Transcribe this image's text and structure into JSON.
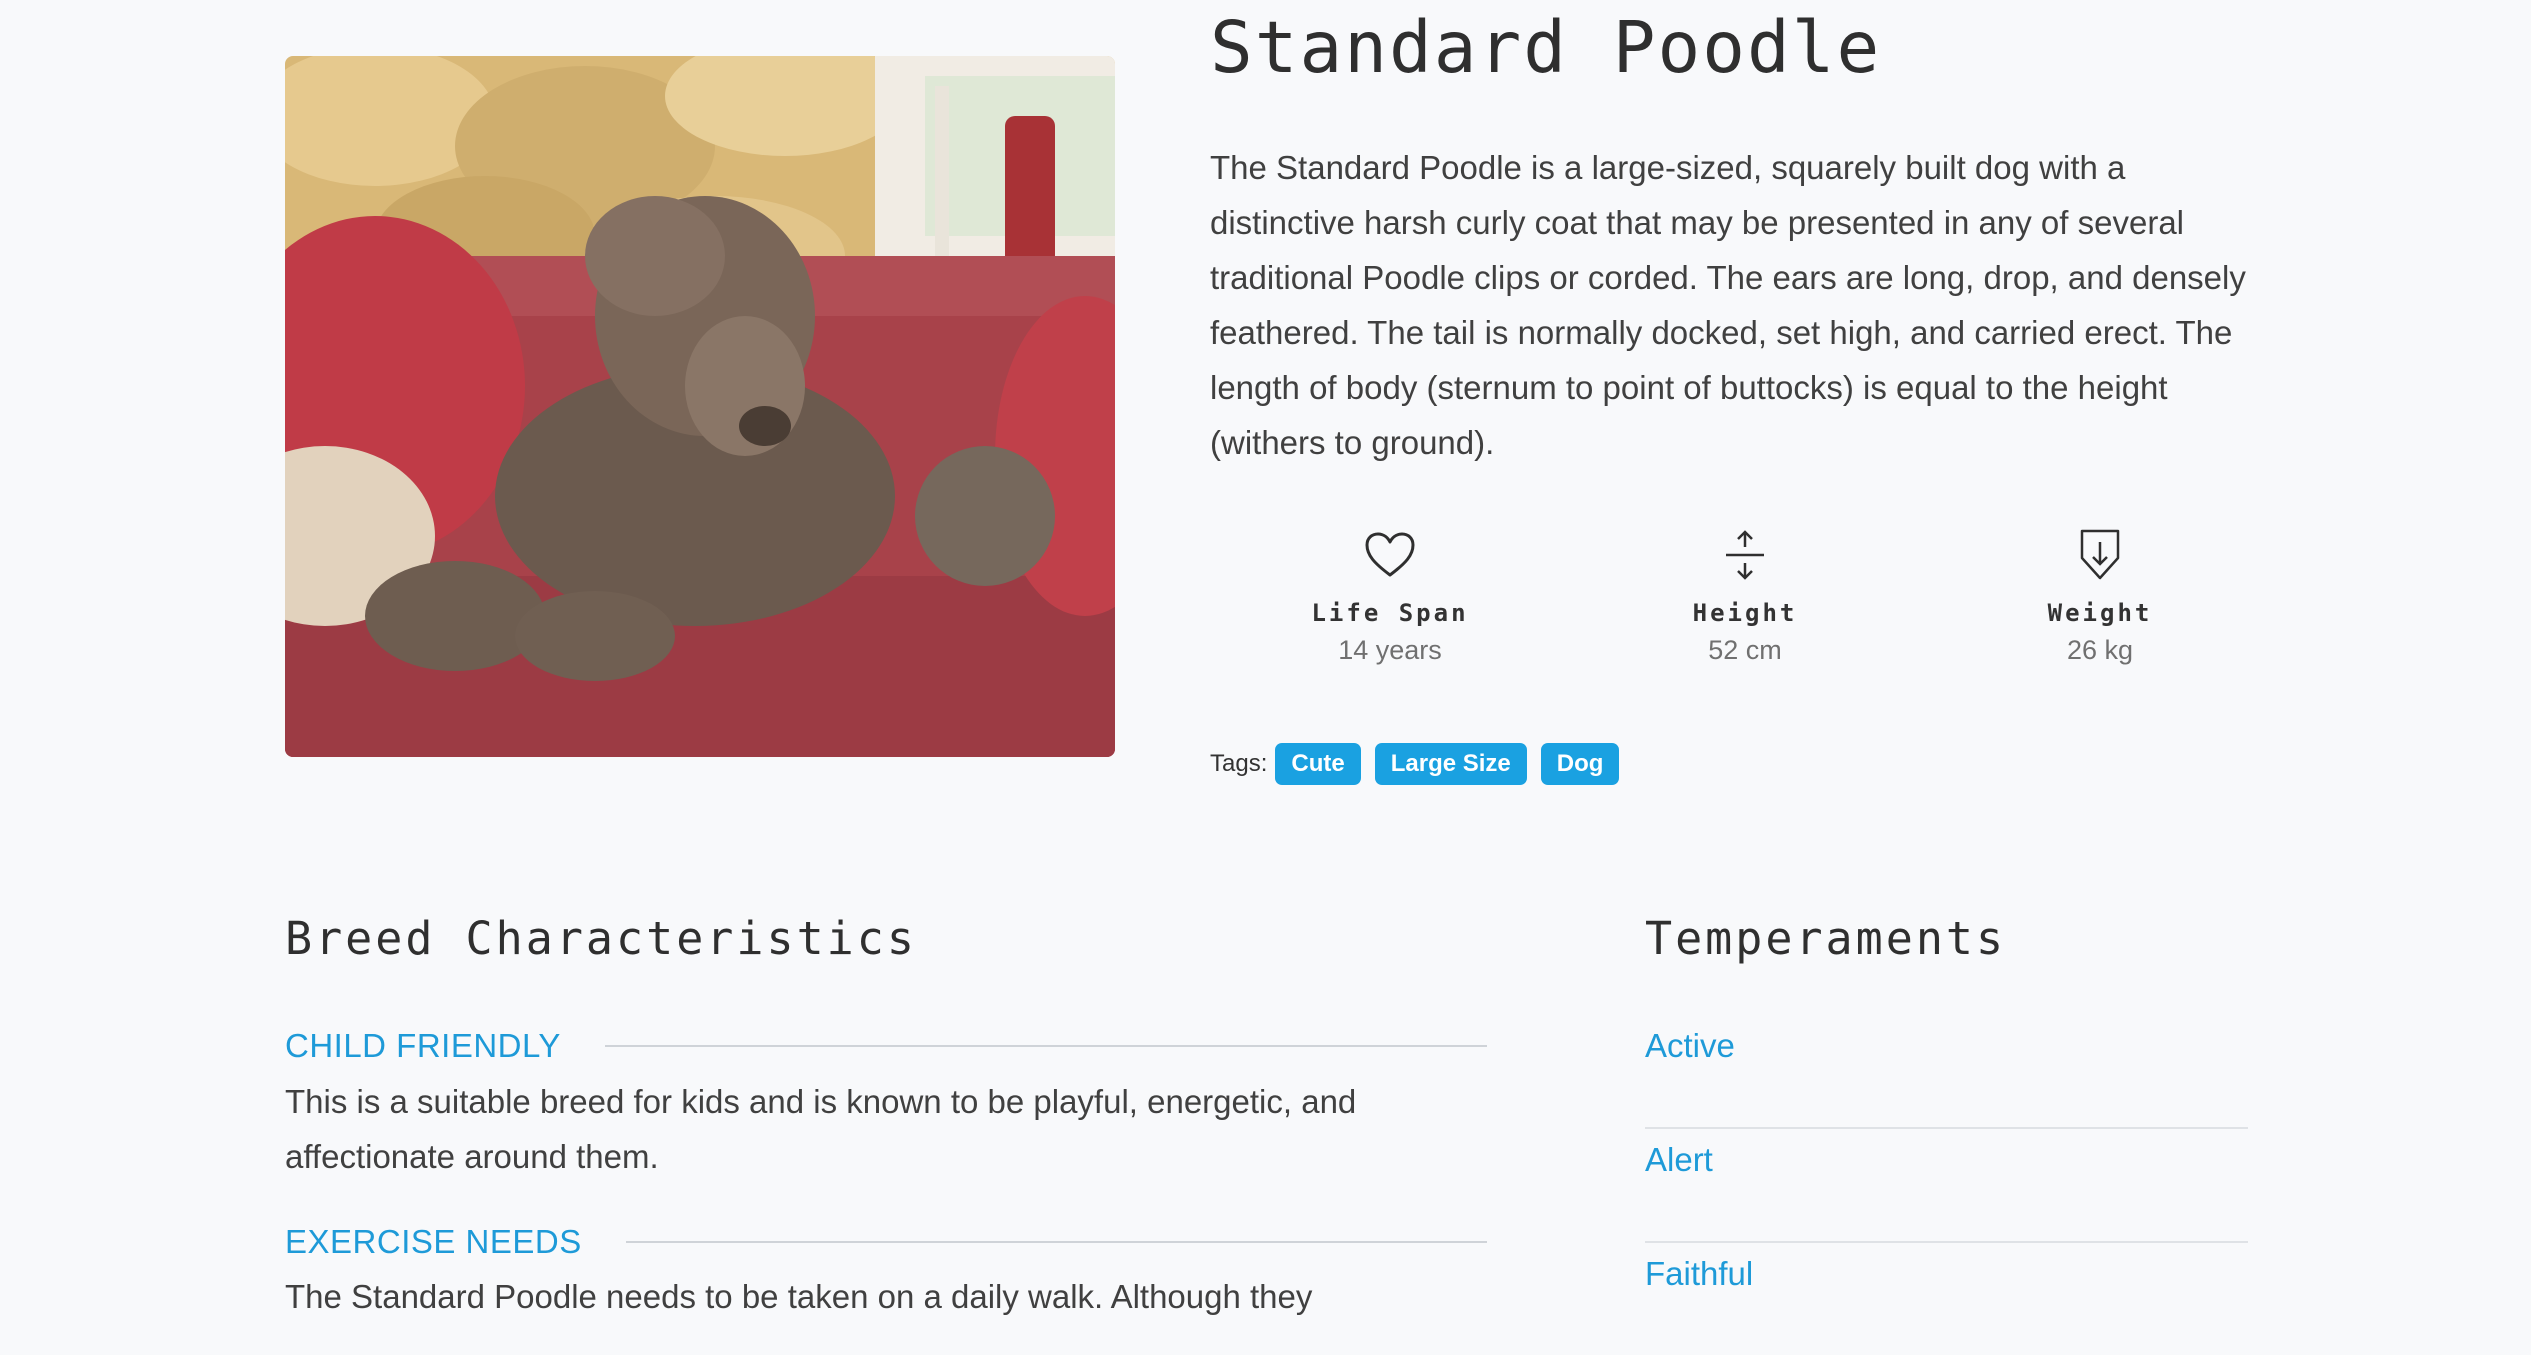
{
  "breed": {
    "name": "Standard Poodle",
    "description": "The Standard Poodle is a large-sized, squarely built dog with a distinctive harsh curly coat that may be presented in any of several traditional Poodle clips or corded. The ears are long, drop, and densely feathered. The tail is normally docked, set high, and carried erect. The length of body (sternum to point of buttocks) is equal to the height (withers to ground).",
    "photo_icon": "poodle-photo"
  },
  "stats": [
    {
      "icon": "heart-icon",
      "label": "Life Span",
      "value": "14 years"
    },
    {
      "icon": "height-arrows-icon",
      "label": "Height",
      "value": "52 cm"
    },
    {
      "icon": "weight-arrow-icon",
      "label": "Weight",
      "value": "26 kg"
    }
  ],
  "tags": {
    "label": "Tags:",
    "items": [
      "Cute",
      "Large Size",
      "Dog"
    ]
  },
  "characteristics": {
    "heading": "Breed Characteristics",
    "items": [
      {
        "name": "Child Friendly",
        "text": "This is a suitable breed for kids and is known to be playful, energetic, and affectionate around them."
      },
      {
        "name": "Exercise Needs",
        "text": "The Standard Poodle needs to be taken on a daily walk. Although they"
      }
    ]
  },
  "temperaments": {
    "heading": "Temperaments",
    "items": [
      "Active",
      "Alert",
      "Faithful"
    ]
  },
  "colors": {
    "accent": "#1aa1e1",
    "link": "#1e9ad8",
    "background": "#f8f9fb"
  }
}
